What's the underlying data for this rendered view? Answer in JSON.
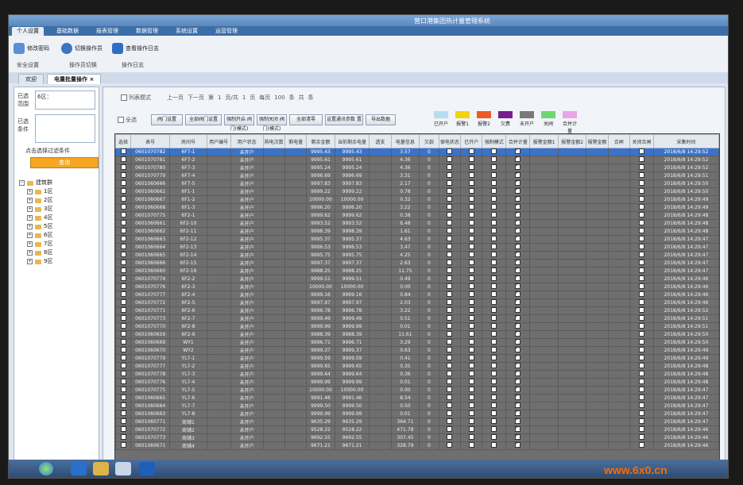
{
  "window": {
    "title": "营口港集团热计量管理系统"
  },
  "menu_tabs": [
    "个人设置",
    "基础数据",
    "报表管理",
    "数据管理",
    "系统设置",
    "运营管理"
  ],
  "ribbon": {
    "buttons": [
      "修改密码",
      "切换操作员",
      "查看操作日志"
    ],
    "groups": [
      "安全设置",
      "操作员切换",
      "操作日志"
    ]
  },
  "doc_tabs": [
    "欢迎",
    "电量批量操作"
  ],
  "left_panel": {
    "selected_range_label": "已选范围",
    "selected_range_value": "6区：",
    "selected_cond_label": "已选条件",
    "add_cond_label": "点击选择过滤条件",
    "query_button": "查询",
    "tree_root": "建筑群",
    "tree_items": [
      "1区",
      "2区",
      "3区",
      "4区",
      "5区",
      "6区",
      "7区",
      "8区",
      "9区"
    ]
  },
  "toolbar": {
    "list_mode": "列表模式",
    "pager": [
      "上一页",
      "下一页",
      "第",
      "1",
      "页/共",
      "1",
      "页",
      "每页",
      "100",
      "条",
      "共",
      "条"
    ],
    "select_all": "全选",
    "buttons": [
      "阀门设置",
      "全部阀门设置",
      "强制开启\n阀门(模式)",
      "强制关闭\n阀门(模式)",
      "全部清零",
      "设置通讯参数\n置",
      "导出数据"
    ]
  },
  "legend": [
    {
      "label": "已开户",
      "color": "#b9dcf0"
    },
    {
      "label": "报警1",
      "color": "#f2d20a"
    },
    {
      "label": "报警2",
      "color": "#f05a28"
    },
    {
      "label": "欠费",
      "color": "#7a1d8c"
    },
    {
      "label": "未开户",
      "color": "#7a7a7a"
    },
    {
      "label": "关阀",
      "color": "#6fd66f"
    },
    {
      "label": "合并计量",
      "color": "#e8a6e8"
    }
  ],
  "table": {
    "headers": [
      "选择",
      "表号",
      "房间号",
      "用户编号",
      "用户状态",
      "购电次数",
      "剩电量",
      "剩余金额",
      "当前剩余电量",
      "透支",
      "电量信息",
      "欠款",
      "保电状态",
      "已开户",
      "强制模式",
      "合并计量",
      "报警金额1",
      "报警金额2",
      "报警金额",
      "合闸",
      "关闭合闸",
      "采集时间"
    ],
    "rows": [
      {
        "meter": "0601070782",
        "room": "6F7-1",
        "status": "未开户",
        "v1": "9995.43",
        "v2": "9995.43",
        "p": "3.57",
        "t": "2018/6/8 14:29:52",
        "sel": true
      },
      {
        "meter": "0601070781",
        "room": "6F7-2",
        "status": "未开户",
        "v1": "9995.61",
        "v2": "9995.61",
        "p": "4.36",
        "t": "2018/6/8 14:29:52"
      },
      {
        "meter": "0601070780",
        "room": "6F7-3",
        "status": "未开户",
        "v1": "9995.24",
        "v2": "9995.24",
        "p": "4.36",
        "t": "2018/6/8 14:29:52"
      },
      {
        "meter": "0601070779",
        "room": "6F7-4",
        "status": "未开户",
        "v1": "9996.69",
        "v2": "9996.69",
        "p": "3.31",
        "t": "2018/6/8 14:29:51"
      },
      {
        "meter": "0601060666",
        "room": "6F7-5",
        "status": "未开户",
        "v1": "9997.83",
        "v2": "9997.83",
        "p": "2.17",
        "t": "2018/6/8 14:29:50"
      },
      {
        "meter": "0601060662",
        "room": "6F1-1",
        "status": "未开户",
        "v1": "9999.22",
        "v2": "9999.22",
        "p": "0.78",
        "t": "2018/6/8 14:29:50"
      },
      {
        "meter": "0601060667",
        "room": "6F1-2",
        "status": "未开户",
        "v1": "10000.00",
        "v2": "10000.00",
        "p": "0.32",
        "t": "2018/6/8 14:29:49"
      },
      {
        "meter": "0601060668",
        "room": "6F1-3",
        "status": "未开户",
        "v1": "9996.20",
        "v2": "9996.20",
        "p": "3.22",
        "t": "2018/6/8 14:29:49"
      },
      {
        "meter": "0601070775",
        "room": "6F2-1",
        "status": "未开户",
        "v1": "9999.62",
        "v2": "9999.62",
        "p": "0.38",
        "t": "2018/6/8 14:29:48"
      },
      {
        "meter": "0601060661",
        "room": "6F2-10",
        "status": "未开户",
        "v1": "9993.52",
        "v2": "9993.52",
        "p": "6.48",
        "t": "2018/6/8 14:29:48"
      },
      {
        "meter": "0601060662",
        "room": "6F2-11",
        "status": "未开户",
        "v1": "9998.39",
        "v2": "9998.39",
        "p": "1.61",
        "t": "2018/6/8 14:29:48"
      },
      {
        "meter": "0601060663",
        "room": "6F2-12",
        "status": "未开户",
        "v1": "9995.37",
        "v2": "9995.37",
        "p": "4.63",
        "t": "2018/6/8 14:29:47"
      },
      {
        "meter": "0601060664",
        "room": "6F2-13",
        "status": "未开户",
        "v1": "9996.53",
        "v2": "9996.53",
        "p": "3.47",
        "t": "2018/6/8 14:29:47"
      },
      {
        "meter": "0601060665",
        "room": "6F2-14",
        "status": "未开户",
        "v1": "9995.75",
        "v2": "9995.75",
        "p": "4.25",
        "t": "2018/6/8 14:29:47"
      },
      {
        "meter": "0601060666",
        "room": "6F2-15",
        "status": "未开户",
        "v1": "9997.37",
        "v2": "9997.37",
        "p": "2.63",
        "t": "2018/6/8 14:29:47"
      },
      {
        "meter": "0601060660",
        "room": "6F2-16",
        "status": "未开户",
        "v1": "9988.25",
        "v2": "9988.25",
        "p": "11.75",
        "t": "2018/6/8 14:29:47"
      },
      {
        "meter": "0601070774",
        "room": "6F2-2",
        "status": "未开户",
        "v1": "9999.51",
        "v2": "9999.51",
        "p": "0.49",
        "t": "2018/6/8 14:29:46"
      },
      {
        "meter": "0601070776",
        "room": "6F2-3",
        "status": "未开户",
        "v1": "10000.00",
        "v2": "10000.00",
        "p": "0.00",
        "t": "2018/6/8 14:29:46"
      },
      {
        "meter": "0601070777",
        "room": "6F2-4",
        "status": "未开户",
        "v1": "9999.16",
        "v2": "9999.16",
        "p": "0.84",
        "t": "2018/6/8 14:29:46"
      },
      {
        "meter": "0601070772",
        "room": "6F2-5",
        "status": "未开户",
        "v1": "9997.97",
        "v2": "9997.97",
        "p": "2.03",
        "t": "2018/6/8 14:29:46"
      },
      {
        "meter": "0601070771",
        "room": "6F2-6",
        "status": "未开户",
        "v1": "9996.78",
        "v2": "9996.78",
        "p": "3.22",
        "t": "2018/6/8 14:29:52"
      },
      {
        "meter": "0601070773",
        "room": "6F2-7",
        "status": "未开户",
        "v1": "9999.49",
        "v2": "9999.49",
        "p": "0.51",
        "t": "2018/6/8 14:29:51"
      },
      {
        "meter": "0601070770",
        "room": "6F2-8",
        "status": "未开户",
        "v1": "9999.99",
        "v2": "9999.99",
        "p": "0.01",
        "t": "2018/6/8 14:29:51"
      },
      {
        "meter": "0601060659",
        "room": "6F2-9",
        "status": "未开户",
        "v1": "9988.39",
        "v2": "9988.39",
        "p": "11.61",
        "t": "2018/6/8 14:29:50"
      },
      {
        "meter": "0601060669",
        "room": "WY1",
        "status": "未开户",
        "v1": "9996.71",
        "v2": "9996.71",
        "p": "3.29",
        "t": "2018/6/8 14:29:50"
      },
      {
        "meter": "0601060670",
        "room": "WY2",
        "status": "未开户",
        "v1": "9999.37",
        "v2": "9999.37",
        "p": "0.63",
        "t": "2018/6/8 14:29:49"
      },
      {
        "meter": "0601070779",
        "room": "YL7-1",
        "status": "未开户",
        "v1": "9999.59",
        "v2": "9999.59",
        "p": "0.41",
        "t": "2018/6/8 14:29:49"
      },
      {
        "meter": "0601070777",
        "room": "YL7-2",
        "status": "未开户",
        "v1": "9999.65",
        "v2": "9999.65",
        "p": "0.35",
        "t": "2018/6/8 14:29:48"
      },
      {
        "meter": "0601070778",
        "room": "YL7-3",
        "status": "未开户",
        "v1": "9999.64",
        "v2": "9999.64",
        "p": "0.36",
        "t": "2018/6/8 14:29:48"
      },
      {
        "meter": "0601070776",
        "room": "YL7-4",
        "status": "未开户",
        "v1": "9999.99",
        "v2": "9999.99",
        "p": "0.01",
        "t": "2018/6/8 14:29:48"
      },
      {
        "meter": "0601070775",
        "room": "YL7-5",
        "status": "未开户",
        "v1": "10000.00",
        "v2": "10000.00",
        "p": "0.00",
        "t": "2018/6/8 14:29:47"
      },
      {
        "meter": "0601060665",
        "room": "YL7-6",
        "status": "未开户",
        "v1": "9991.46",
        "v2": "9991.46",
        "p": "8.54",
        "t": "2018/6/8 14:29:47"
      },
      {
        "meter": "0601060664",
        "room": "YL7-7",
        "status": "未开户",
        "v1": "9999.50",
        "v2": "9999.50",
        "p": "0.50",
        "t": "2018/6/8 14:29:47"
      },
      {
        "meter": "0601060663",
        "room": "YL7-8",
        "status": "未开户",
        "v1": "9999.99",
        "v2": "9999.99",
        "p": "0.01",
        "t": "2018/6/8 14:29:47"
      },
      {
        "meter": "0601060771",
        "room": "商铺1",
        "status": "未开户",
        "v1": "9635.29",
        "v2": "9635.29",
        "p": "364.71",
        "t": "2018/6/8 14:29:47"
      },
      {
        "meter": "0601070772",
        "room": "商铺2",
        "status": "未开户",
        "v1": "9528.22",
        "v2": "9528.22",
        "p": "471.78",
        "t": "2018/6/8 14:29:46"
      },
      {
        "meter": "0601070773",
        "room": "商铺3",
        "status": "未开户",
        "v1": "9692.55",
        "v2": "9692.55",
        "p": "307.45",
        "t": "2018/6/8 14:29:46"
      },
      {
        "meter": "0601060671",
        "room": "商铺4",
        "status": "未开户",
        "v1": "9671.21",
        "v2": "9671.21",
        "p": "328.79",
        "t": "2018/6/8 14:29:46"
      }
    ]
  }
}
